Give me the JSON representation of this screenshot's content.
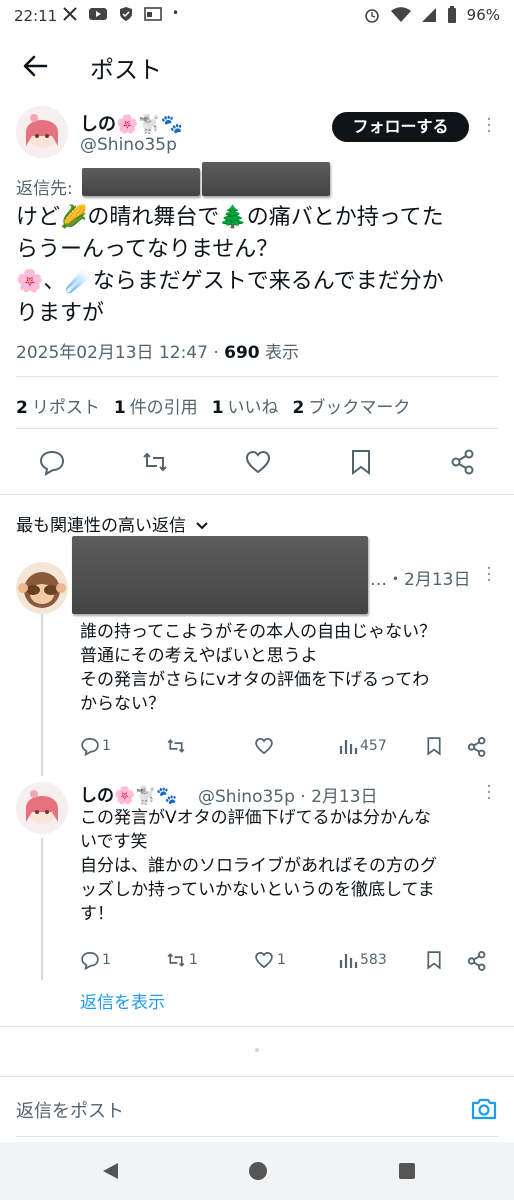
{
  "status_bar": {
    "time": "22:11",
    "battery": "96%"
  },
  "header": {
    "title": "ポスト"
  },
  "post": {
    "author_name": "しの🌸🐩🐾",
    "author_handle": "@Shino35p",
    "follow_label": "フォローする",
    "reply_to_label": "返信先:",
    "body_lines": [
      "けど🌽の晴れ舞台で🌲の痛バとか持ってた",
      "らうーんってなりません？",
      "🌸、☄️ならまだゲストで来るんでまだ分か",
      "りますが"
    ],
    "timestamp": "2025年02月13日 12:47 · ",
    "view_count": "690",
    "view_label": " 表示",
    "stats": {
      "reposts": "2",
      "reposts_label": "リポスト",
      "quotes": "1",
      "quotes_label": "件の引用",
      "likes": "1",
      "likes_label": "いいね",
      "bookmarks": "2",
      "bookmarks_label": "ブックマーク"
    }
  },
  "replies_section": {
    "title": "最も関連性の高い返信"
  },
  "reply1": {
    "date": "…・2月13日",
    "lines": [
      "誰の持ってこようがその本人の自由じゃない？",
      "普通にその考えやばいと思うよ",
      "その発言がさらにvオタの評価を下げるってわ",
      "からない？"
    ],
    "replies": "1",
    "reposts": "",
    "likes": "",
    "views": "457"
  },
  "reply2": {
    "name": "しの🌸🐩🐾",
    "handle_date": "@Shino35p · 2月13日",
    "lines": [
      "この発言がVオタの評価下げてるかは分かんな",
      "いです笑",
      "自分は、誰かのソロライブがあればその方のグ",
      "ッズしか持っていかないというのを徹底してま",
      "す！"
    ],
    "replies": "1",
    "reposts": "1",
    "likes": "1",
    "views": "583"
  },
  "show_replies": "返信を表示",
  "compose": {
    "placeholder": "返信をポスト"
  },
  "colors": {
    "link": "#1d9bf0",
    "text": "#0f1419",
    "secondary": "#536471",
    "follow_bg": "#0f1419"
  }
}
